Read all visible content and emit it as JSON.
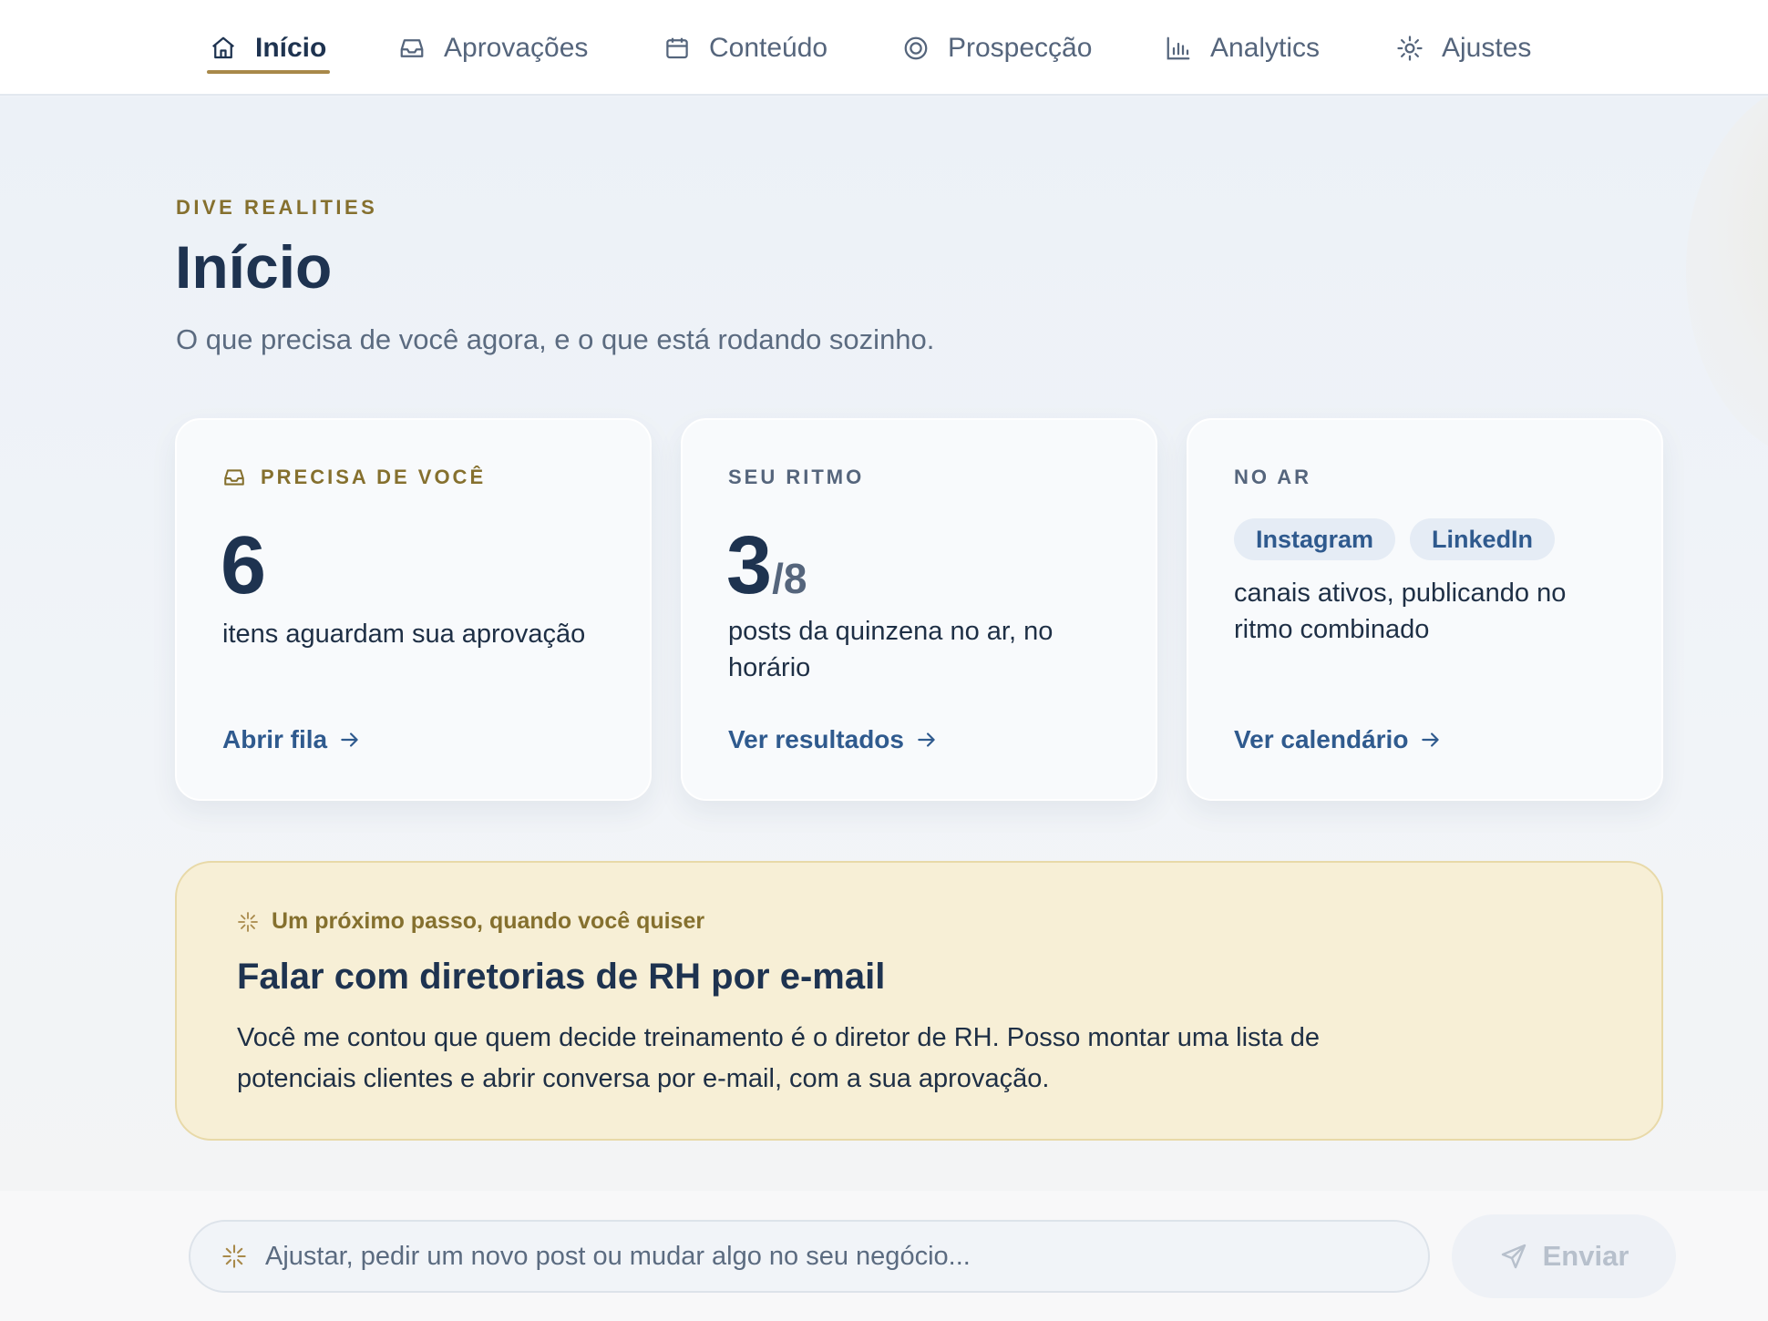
{
  "nav": {
    "items": [
      {
        "label": "Início",
        "icon": "home-icon",
        "active": true
      },
      {
        "label": "Aprovações",
        "icon": "inbox-icon",
        "active": false
      },
      {
        "label": "Conteúdo",
        "icon": "calendar-icon",
        "active": false
      },
      {
        "label": "Prospecção",
        "icon": "target-icon",
        "active": false
      },
      {
        "label": "Analytics",
        "icon": "bar-chart-icon",
        "active": false
      },
      {
        "label": "Ajustes",
        "icon": "sun-gear-icon",
        "active": false
      }
    ]
  },
  "header": {
    "eyebrow": "DIVE REALITIES",
    "title": "Início",
    "subtitle": "O que precisa de você agora, e o que está rodando sozinho."
  },
  "cards": {
    "needs_you": {
      "label": "PRECISA DE VOCÊ",
      "number": "6",
      "text": "itens aguardam sua aprovação",
      "link": "Abrir fila"
    },
    "rhythm": {
      "label": "SEU RITMO",
      "number": "3",
      "denominator": "/8",
      "text": "posts da quinzena no ar, no horário",
      "link": "Ver resultados"
    },
    "on_air": {
      "label": "NO AR",
      "chips": [
        "Instagram",
        "LinkedIn"
      ],
      "text": "canais ativos, publicando no ritmo combinado",
      "link": "Ver calendário"
    }
  },
  "banner": {
    "kicker": "Um próximo passo, quando você quiser",
    "title": "Falar com diretorias de RH por e-mail",
    "body": "Você me contou que quem decide treinamento é o diretor de RH. Posso montar uma lista de potenciais clientes e abrir conversa por e-mail, com a sua aprovação."
  },
  "composer": {
    "placeholder": "Ajustar, pedir um novo post ou mudar algo no seu negócio...",
    "value": "",
    "send_label": "Enviar"
  },
  "colors": {
    "accent_gold": "#a8894a",
    "text_navy": "#1e3350",
    "link_blue": "#2f5a8e",
    "banner_bg": "#f7efd6"
  }
}
